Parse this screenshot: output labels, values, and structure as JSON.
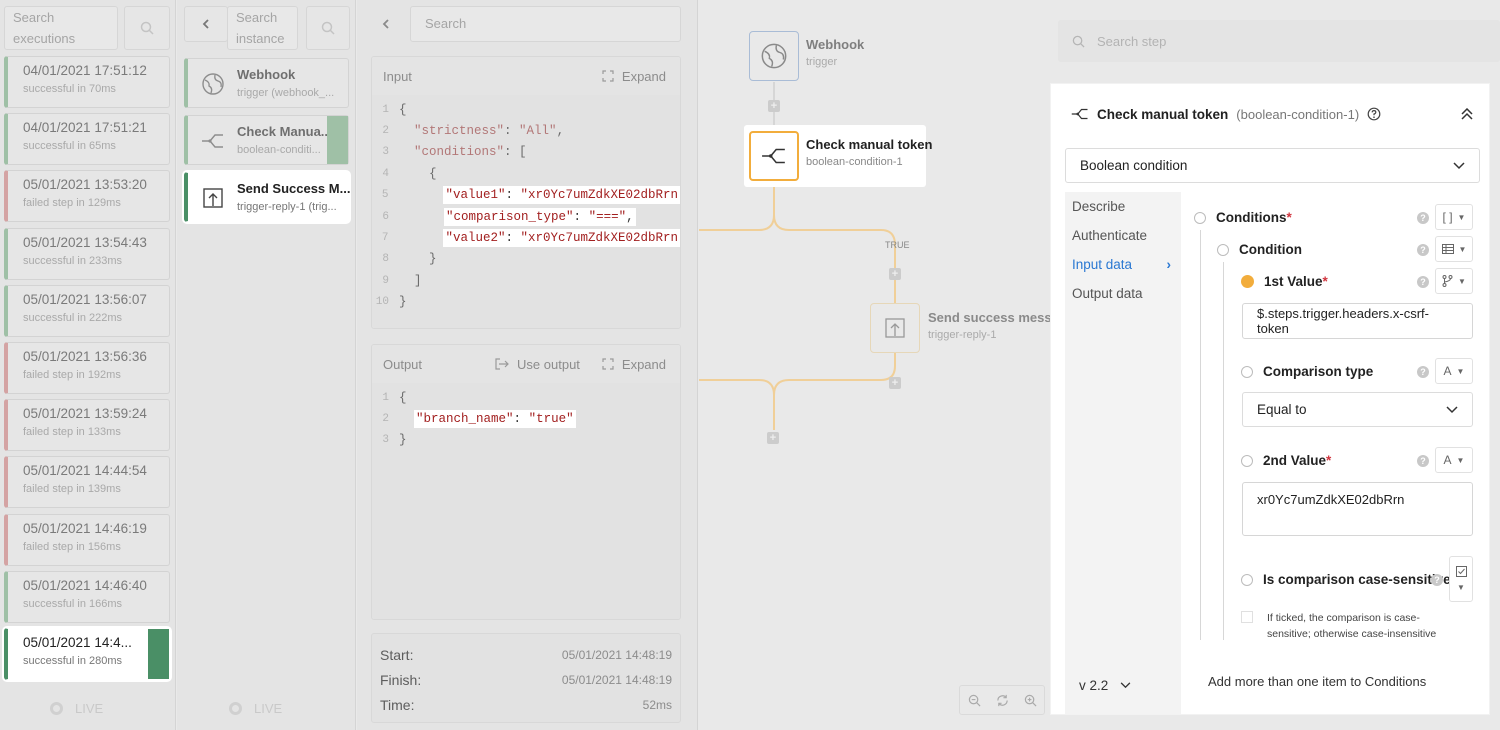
{
  "executions": {
    "search_placeholder": "Search executions",
    "items": [
      {
        "time": "04/01/2021 17:51:12",
        "status": "successful in 70ms",
        "state": "success"
      },
      {
        "time": "04/01/2021 17:51:21",
        "status": "successful in 65ms",
        "state": "success"
      },
      {
        "time": "05/01/2021 13:53:20",
        "status": "failed step in 129ms",
        "state": "failed"
      },
      {
        "time": "05/01/2021 13:54:43",
        "status": "successful in 233ms",
        "state": "success"
      },
      {
        "time": "05/01/2021 13:56:07",
        "status": "successful in 222ms",
        "state": "success"
      },
      {
        "time": "05/01/2021 13:56:36",
        "status": "failed step in 192ms",
        "state": "failed"
      },
      {
        "time": "05/01/2021 13:59:24",
        "status": "failed step in 133ms",
        "state": "failed"
      },
      {
        "time": "05/01/2021 14:44:54",
        "status": "failed step in 139ms",
        "state": "failed"
      },
      {
        "time": "05/01/2021 14:46:19",
        "status": "failed step in 156ms",
        "state": "failed"
      },
      {
        "time": "05/01/2021 14:46:40",
        "status": "successful in 166ms",
        "state": "success"
      },
      {
        "time": "05/01/2021 14:4...",
        "status": "successful in 280ms",
        "state": "success"
      }
    ],
    "live_label": "LIVE"
  },
  "instances": {
    "back_icon": "chevron-left-icon",
    "search_placeholder": "Search instance",
    "items": [
      {
        "title": "Webhook",
        "subtitle": "trigger (webhook_...",
        "icon": "globe-icon"
      },
      {
        "title": "Check Manua...",
        "subtitle": "boolean-conditi...",
        "icon": "branch-icon"
      },
      {
        "title": "Send Success M...",
        "subtitle": "trigger-reply-1 (trig...",
        "icon": "upload-box-icon"
      }
    ],
    "live_label": "LIVE"
  },
  "io": {
    "search_placeholder": "Search",
    "input_label": "Input",
    "expand_label": "Expand",
    "input_code": [
      {
        "text": "{"
      },
      {
        "key": "\"strictness\"",
        "sep": ": ",
        "val": "\"All\"",
        "end": ",",
        "indent": "  "
      },
      {
        "key": "\"conditions\"",
        "sep": ": ",
        "val": "",
        "end": "[",
        "indent": "  "
      },
      {
        "text": "    {"
      },
      {
        "key": "\"value1\"",
        "sep": ": ",
        "val": "\"xr0Yc7umZdkXE02dbRrn",
        "end": "",
        "indent": "      ",
        "hl": true
      },
      {
        "key": "\"comparison_type\"",
        "sep": ": ",
        "val": "\"===\"",
        "end": ",",
        "indent": "      ",
        "hl": true
      },
      {
        "key": "\"value2\"",
        "sep": ": ",
        "val": "\"xr0Yc7umZdkXE02dbRrn",
        "end": "",
        "indent": "      ",
        "hl": true
      },
      {
        "text": "    }"
      },
      {
        "text": "  ]"
      },
      {
        "text": "}"
      }
    ],
    "output_label": "Output",
    "use_output_label": "Use output",
    "output_code": [
      {
        "text": "{"
      },
      {
        "key": "\"branch_name\"",
        "sep": ": ",
        "val": "\"true\"",
        "end": "",
        "indent": "  ",
        "hl": true
      },
      {
        "text": "}"
      }
    ],
    "start_label": "Start:",
    "start_value": "05/01/2021 14:48:19",
    "finish_label": "Finish:",
    "finish_value": "05/01/2021 14:48:19",
    "time_label": "Time:",
    "time_value": "52ms"
  },
  "canvas": {
    "webhook": {
      "title": "Webhook",
      "subtitle": "trigger"
    },
    "check": {
      "title": "Check manual token",
      "subtitle": "boolean-condition-1"
    },
    "true_label": "TRUE",
    "send": {
      "title": "Send success message",
      "subtitle": "trigger-reply-1"
    },
    "zoom_out_icon": "zoom-out-icon",
    "reset_icon": "refresh-icon",
    "zoom_in_icon": "zoom-in-icon"
  },
  "side": {
    "search_placeholder": "Search step",
    "title": "Check manual token",
    "subtitle": "(boolean-condition-1)",
    "step_type": "Boolean condition",
    "tabs": [
      "Describe",
      "Authenticate",
      "Input data",
      "Output data"
    ],
    "active_tab": "Input data",
    "conditions_label": "Conditions",
    "condition_label": "Condition",
    "value1_label": "1st Value",
    "value1": "$.steps.trigger.headers.x-csrf-token",
    "comparison_label": "Comparison type",
    "comparison_value": "Equal to",
    "value2_label": "2nd Value",
    "value2": "xr0Yc7umZdkXE02dbRrn",
    "case_label": "Is comparison case-sensitive?",
    "case_help": "If ticked, the comparison is case-sensitive; otherwise case-insensitive",
    "type_a": "A",
    "add_more": "Add more than one item to Conditions",
    "version": "v 2.2",
    "required_mark": "*"
  },
  "colors": {
    "success": "#4a8f66",
    "failed": "#d4a3a3",
    "accent": "#2a78d2",
    "node_highlight": "#f2ad3c",
    "required": "#d0343e"
  }
}
